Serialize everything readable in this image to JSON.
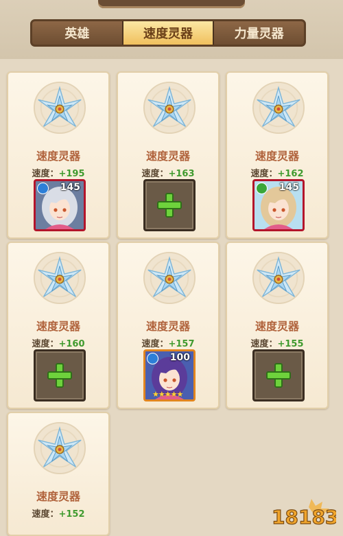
{
  "tabs": [
    {
      "label": "英雄",
      "active": false
    },
    {
      "label": "速度灵器",
      "active": true
    },
    {
      "label": "力量灵器",
      "active": false
    }
  ],
  "stat_label": "速度：",
  "cards": [
    {
      "title": "速度灵器",
      "bonus": "+195",
      "slot": "hero",
      "level": "145",
      "element": "water",
      "frame": "red"
    },
    {
      "title": "速度灵器",
      "bonus": "+163",
      "slot": "empty"
    },
    {
      "title": "速度灵器",
      "bonus": "+162",
      "slot": "hero",
      "level": "145",
      "element": "wind",
      "frame": "red"
    },
    {
      "title": "速度灵器",
      "bonus": "+160",
      "slot": "empty"
    },
    {
      "title": "速度灵器",
      "bonus": "+157",
      "slot": "hero",
      "level": "100",
      "element": "water",
      "frame": "orange",
      "stars": "★★★★★"
    },
    {
      "title": "速度灵器",
      "bonus": "+155",
      "slot": "empty"
    },
    {
      "title": "速度灵器",
      "bonus": "+152",
      "slot": "none"
    }
  ],
  "watermark": "18183",
  "colors": {
    "accent": "#f0c05e",
    "bonus_green": "#3f9a2e",
    "title_orange": "#b0623b"
  }
}
